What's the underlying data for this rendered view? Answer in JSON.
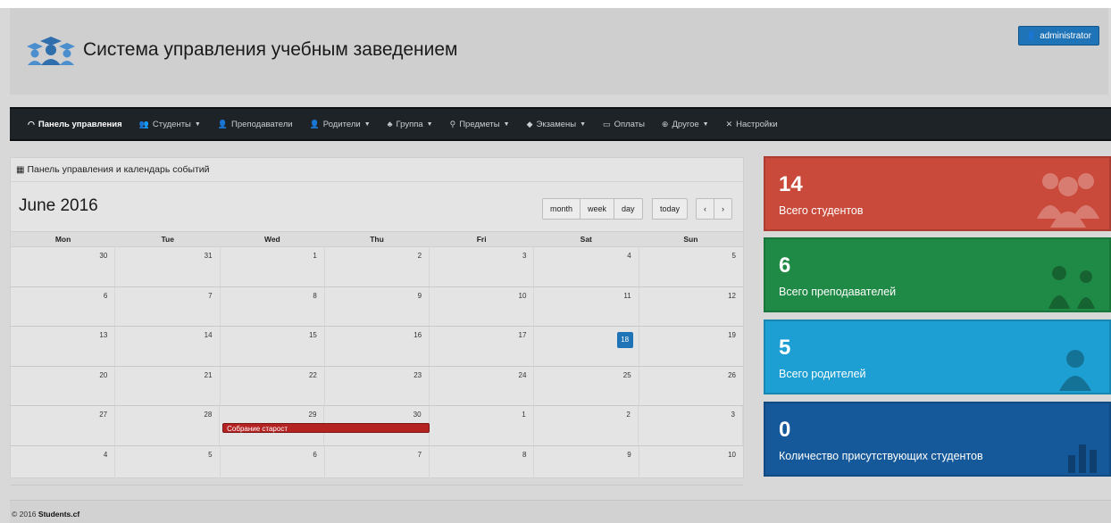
{
  "header": {
    "title": "Система управления учебным заведением",
    "logo_icon": "graduates-icon",
    "user_button": "administrator"
  },
  "nav": {
    "items": [
      {
        "label": "Панель управления",
        "icon": "dashboard-icon",
        "active": true,
        "dropdown": false
      },
      {
        "label": "Студенты",
        "icon": "users-icon",
        "dropdown": true
      },
      {
        "label": "Преподаватели",
        "icon": "teachers-icon",
        "dropdown": false
      },
      {
        "label": "Родители",
        "icon": "user-icon",
        "dropdown": true
      },
      {
        "label": "Группа",
        "icon": "sitemap-icon",
        "dropdown": true
      },
      {
        "label": "Предметы",
        "icon": "subjects-icon",
        "dropdown": true
      },
      {
        "label": "Экзамены",
        "icon": "graduation-cap-icon",
        "dropdown": true
      },
      {
        "label": "Оплаты",
        "icon": "card-icon",
        "dropdown": false
      },
      {
        "label": "Другое",
        "icon": "circle-plus-icon",
        "dropdown": true
      },
      {
        "label": "Настройки",
        "icon": "tools-icon",
        "dropdown": false
      }
    ]
  },
  "calendar": {
    "panel_title": "Панель управления и календарь событий",
    "month_title": "June 2016",
    "view_buttons": [
      "month",
      "week",
      "day"
    ],
    "today_label": "today",
    "prev_label": "‹",
    "next_label": "›",
    "day_names": [
      "Mon",
      "Tue",
      "Wed",
      "Thu",
      "Fri",
      "Sat",
      "Sun"
    ],
    "weeks": [
      [
        "30",
        "31",
        "1",
        "2",
        "3",
        "4",
        "5"
      ],
      [
        "6",
        "7",
        "8",
        "9",
        "10",
        "11",
        "12"
      ],
      [
        "13",
        "14",
        "15",
        "16",
        "17",
        "18",
        "19"
      ],
      [
        "20",
        "21",
        "22",
        "23",
        "24",
        "25",
        "26"
      ],
      [
        "27",
        "28",
        "29",
        "30",
        "1",
        "2",
        "3"
      ],
      [
        "4",
        "5",
        "6",
        "7",
        "8",
        "9",
        "10"
      ]
    ],
    "today": "18",
    "event": {
      "title": "Собрание старост",
      "start": "2016-06-28",
      "end": "2016-06-30",
      "color": "#b42222"
    }
  },
  "stats": [
    {
      "value": "14",
      "label": "Всего студентов",
      "color": "#c9493a",
      "icon": "users-icon"
    },
    {
      "value": "6",
      "label": "Всего преподавателей",
      "color": "#1f8a45",
      "icon": "teachers-icon"
    },
    {
      "value": "5",
      "label": "Всего родителей",
      "color": "#1d9fd3",
      "icon": "user-icon"
    },
    {
      "value": "0",
      "label": "Количество присутствующих студентов",
      "color": "#16599b",
      "icon": "bar-chart-icon"
    }
  ],
  "footer": {
    "copyright": "© 2016",
    "site": "Students.cf"
  }
}
